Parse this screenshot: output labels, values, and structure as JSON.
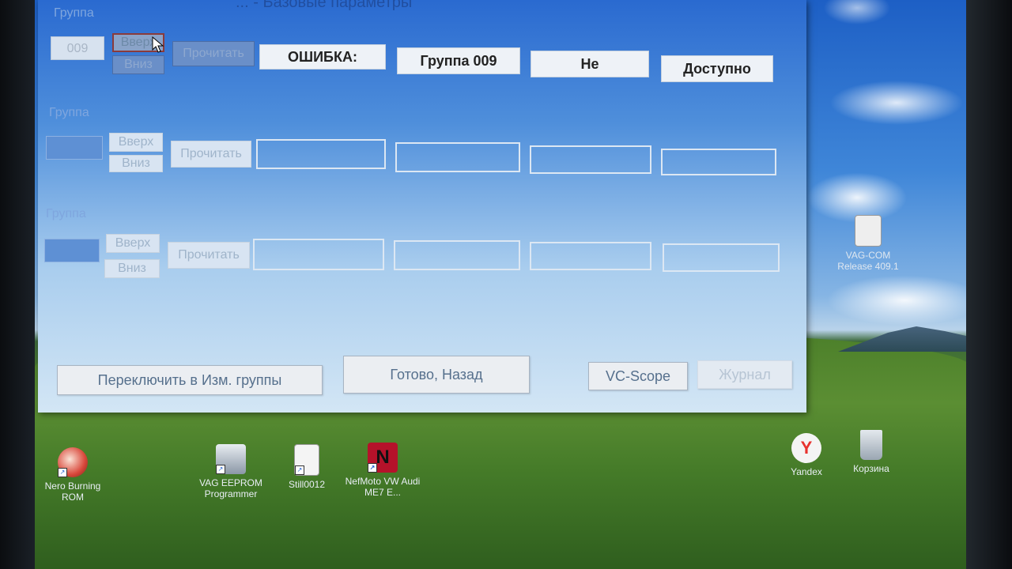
{
  "window": {
    "title": "... - Базовые параметры"
  },
  "groups": [
    {
      "label": "Группа",
      "field_value": "009",
      "up_label": "Вверх",
      "down_label": "Вниз",
      "read_label": "Прочитать",
      "results": [
        "ОШИБКА:",
        "Группа 009",
        "Не",
        "Доступно"
      ]
    },
    {
      "label": "Группа",
      "field_value": "",
      "up_label": "Вверх",
      "down_label": "Вниз",
      "read_label": "Прочитать",
      "results": [
        "",
        "",
        "",
        ""
      ]
    },
    {
      "label": "Группа",
      "field_value": "",
      "up_label": "Вверх",
      "down_label": "Вниз",
      "read_label": "Прочитать",
      "results": [
        "",
        "",
        "",
        ""
      ]
    }
  ],
  "bottom_buttons": {
    "switch_label": "Переключить в Изм. группы",
    "done_label": "Готово, Назад",
    "vcscope_label": "VC-Scope",
    "log_label": "Журнал"
  },
  "desktop_icons": [
    {
      "label": "Nero Burning ROM",
      "icon": "nero-icon",
      "color": "#d9483b"
    },
    {
      "label": "VAG EEPROM Programmer",
      "icon": "car-icon",
      "color": "#c7d0da"
    },
    {
      "label": "Still0012",
      "icon": "document-icon",
      "color": "#f2f2f2"
    },
    {
      "label": "NefMoto VW Audi ME7 E...",
      "icon": "nefmoto-icon",
      "color": "#b5122a"
    },
    {
      "label": "Yandex",
      "icon": "yandex-icon",
      "color": "#e8322e"
    },
    {
      "label": "Корзина",
      "icon": "recycle-bin-icon",
      "color": "#bfc7cf"
    },
    {
      "label": "VAG-COM Release 409.1",
      "icon": "vagcom-icon",
      "color": "#e8e8e8"
    }
  ],
  "colors": {
    "window_top": "#2a6ad0",
    "window_bottom": "#d3e6f5",
    "result_text": "#222222"
  }
}
